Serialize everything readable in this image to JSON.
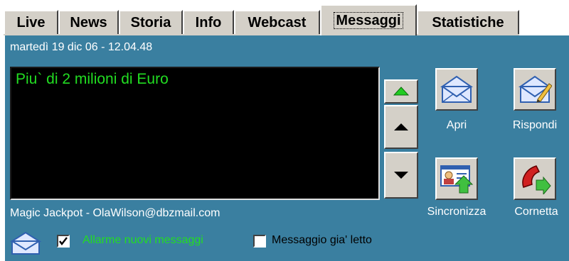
{
  "tabs": [
    {
      "label": "Live",
      "active": false
    },
    {
      "label": "News",
      "active": false
    },
    {
      "label": "Storia",
      "active": false
    },
    {
      "label": "Info",
      "active": false
    },
    {
      "label": "Webcast",
      "active": false
    },
    {
      "label": "Messaggi",
      "active": true
    },
    {
      "label": "Statistiche",
      "active": false
    }
  ],
  "message": {
    "datetime": "martedì 19 dic 06 - 12.04.48",
    "body": "Piu` di 2 milioni di Euro",
    "sender": "Magic Jackpot - OlaWilson@dbzmail.com"
  },
  "actions": {
    "open_label": "Apri",
    "reply_label": "Rispondi",
    "sync_label": "Sincronizza",
    "phone_label": "Cornetta"
  },
  "options": {
    "alarm_label": "Allarme nuovi messaggi",
    "alarm_checked": true,
    "read_label": "Messaggio gia' letto",
    "read_checked": false
  },
  "icons": {
    "scroll_top": "green-up-arrow-icon",
    "scroll_up": "up-arrow-icon",
    "scroll_down": "down-arrow-icon",
    "open": "open-envelope-icon",
    "reply": "envelope-pencil-icon",
    "sync": "contact-card-sync-icon",
    "phone": "red-phone-icon",
    "status": "envelope-icon"
  },
  "colors": {
    "panel": "#3a7fa0",
    "message_text": "#22dd22",
    "alarm_text": "#22dd22",
    "read_text": "#000000"
  }
}
